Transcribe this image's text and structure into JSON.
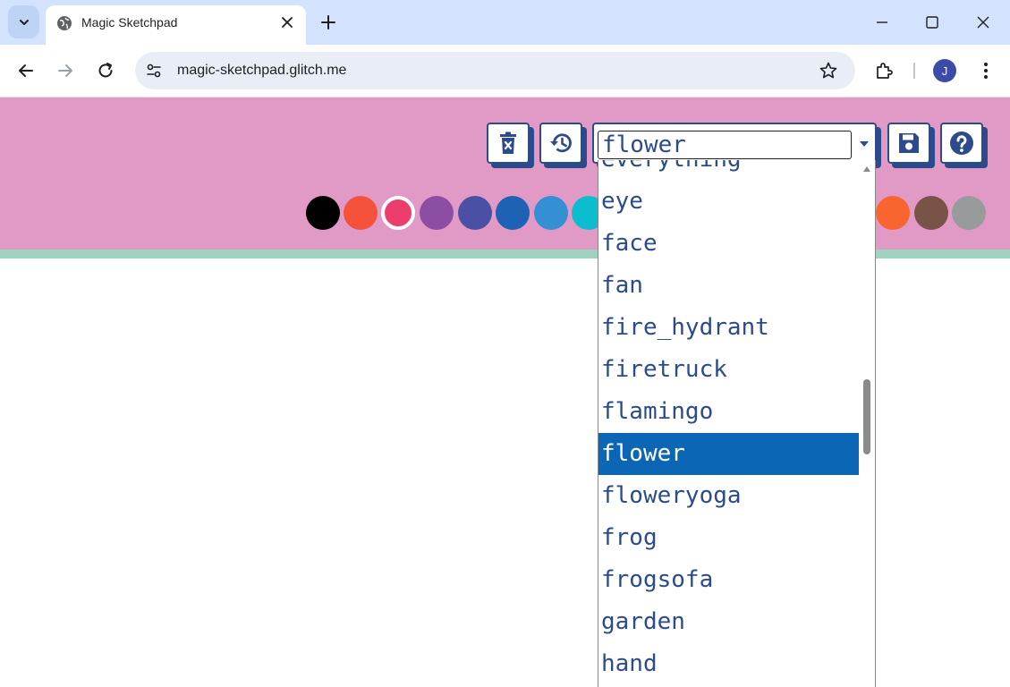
{
  "browser": {
    "tab_title": "Magic Sketchpad",
    "url": "magic-sketchpad.glitch.me",
    "profile_initial": "J"
  },
  "app": {
    "colors": {
      "header_bg": "#e09ac5",
      "strip": "#9dd3c0",
      "accent": "#2b4b8c",
      "highlight": "#0b67b5"
    },
    "tools": {
      "clear_icon": "trash-x-icon",
      "history_icon": "history-icon",
      "save_icon": "floppy-disk-icon",
      "help_icon": "question-mark-icon"
    },
    "category_select": {
      "selected": "flower",
      "options_visible": [
        "everything",
        "eye",
        "face",
        "fan",
        "fire_hydrant",
        "firetruck",
        "flamingo",
        "flower",
        "floweryoga",
        "frog",
        "frogsofa",
        "garden",
        "hand"
      ]
    },
    "palette": [
      "#000000",
      "#f4523b",
      "#ec3d6c",
      "#8c4ea3",
      "#4a51a5",
      "#1e62b5",
      "#3490d2",
      "#0cbdd0",
      "#f9652e",
      "#7a5348",
      "#979b9c"
    ],
    "selected_color_index": 2
  }
}
